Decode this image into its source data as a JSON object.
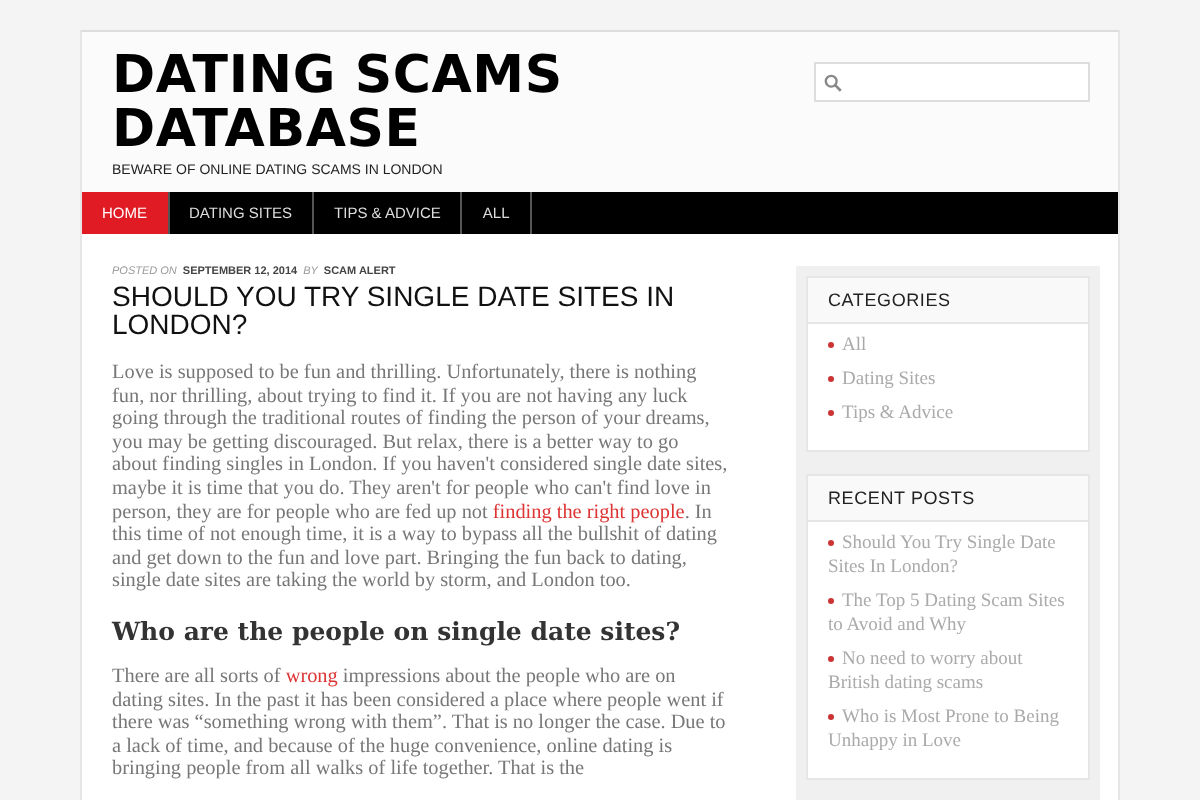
{
  "site": {
    "title": "DATING SCAMS DATABASE",
    "tagline": "BEWARE OF ONLINE DATING SCAMS IN LONDON"
  },
  "nav": [
    {
      "label": "HOME",
      "selected": true
    },
    {
      "label": "DATING SITES",
      "selected": false
    },
    {
      "label": "TIPS & ADVICE",
      "selected": false
    },
    {
      "label": "ALL",
      "selected": false
    }
  ],
  "post": {
    "posted_on_label": "POSTED ON",
    "date": "SEPTEMBER 12, 2014",
    "by_label": "BY",
    "author": "SCAM ALERT",
    "title": "SHOULD YOU TRY SINGLE DATE SITES IN LONDON?",
    "blocks": [
      {
        "kind": "paragraph",
        "parts": [
          {
            "text": "Love is supposed to be fun and thrilling. Unfortunately, there is nothing fun, nor thrilling, about trying to find it. If you are not having any luck going through the traditional routes of finding the person of your dreams, you may be getting discouraged. But relax, there is a better way to go about finding singles in London. If you haven't considered single date sites, maybe it is time that you do. They aren't for people who can't find love in person, they are for people who are fed up not ",
            "link": false
          },
          {
            "text": "finding the right people",
            "link": true
          },
          {
            "text": ". In this time of not enough time, it is a way to bypass all the bullshit of dating and get down to the fun and love part. Bringing the fun back to dating, single date sites are taking the world by storm, and London too.",
            "link": false
          }
        ]
      },
      {
        "kind": "heading",
        "text": "Who are the people on single date sites?"
      },
      {
        "kind": "paragraph",
        "parts": [
          {
            "text": "There are all sorts of ",
            "link": false
          },
          {
            "text": "wrong",
            "link": true
          },
          {
            "text": " impressions about the people who are on dating sites. In the past it has been considered a place where people went if there was “something wrong with them”. That is no longer the case. Due to a lack of time, and because of the huge convenience, online dating is bringing people from all walks of life together. That is the",
            "link": false
          }
        ]
      }
    ]
  },
  "sidebar": [
    {
      "title": "CATEGORIES",
      "items": [
        "All",
        "Dating Sites",
        "Tips & Advice"
      ]
    },
    {
      "title": "RECENT POSTS",
      "items": [
        "Should You Try Single Date Sites In London?",
        "The Top 5 Dating Scam Sites to Avoid and Why",
        "No need to worry about British dating scams",
        "Who is Most Prone to Being Unhappy in Love"
      ]
    }
  ]
}
